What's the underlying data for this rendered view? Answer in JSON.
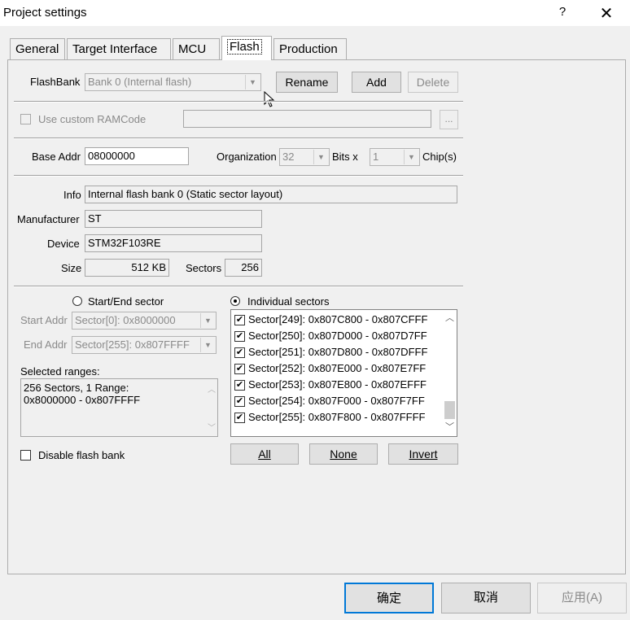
{
  "window": {
    "title": "Project settings",
    "help": "?",
    "close": "✕"
  },
  "tabs": [
    "General",
    "Target Interface",
    "MCU",
    "Flash",
    "Production"
  ],
  "flashbank": {
    "label": "FlashBank",
    "value": "Bank 0 (Internal flash)",
    "rename": "Rename",
    "add": "Add",
    "delete": "Delete"
  },
  "ramcode": {
    "label": "Use custom RAMCode",
    "value": "",
    "browse": "..."
  },
  "base": {
    "base_addr_label": "Base Addr",
    "base_addr": "08000000",
    "org_label": "Organization",
    "org_value": "32",
    "bits_label": "Bits x",
    "chips_value": "1",
    "chips_label": "Chip(s)"
  },
  "info": {
    "info_label": "Info",
    "info": "Internal flash bank 0 (Static sector layout)",
    "manufacturer_label": "Manufacturer",
    "manufacturer": "ST",
    "device_label": "Device",
    "device": "STM32F103RE",
    "size_label": "Size",
    "size": "512 KB",
    "sectors_label": "Sectors",
    "sectors": "256"
  },
  "range": {
    "start_end_label": "Start/End sector",
    "individual_label": "Individual sectors",
    "start_label": "Start Addr",
    "start_value": "Sector[0]: 0x8000000",
    "end_label": "End Addr",
    "end_value": "Sector[255]: 0x807FFFF",
    "selected_label": "Selected ranges:",
    "selected_line1": "256 Sectors, 1 Range:",
    "selected_line2": "0x8000000 - 0x807FFFF"
  },
  "sectors_list": [
    "Sector[249]: 0x807C800 - 0x807CFFF",
    "Sector[250]: 0x807D000 - 0x807D7FF",
    "Sector[251]: 0x807D800 - 0x807DFFF",
    "Sector[252]: 0x807E000 - 0x807E7FF",
    "Sector[253]: 0x807E800 - 0x807EFFF",
    "Sector[254]: 0x807F000 - 0x807F7FF",
    "Sector[255]: 0x807F800 - 0x807FFFF"
  ],
  "list_buttons": {
    "all": "All",
    "none": "None",
    "invert": "Invert"
  },
  "disable_flash_bank": "Disable flash bank",
  "footer": {
    "ok": "确定",
    "cancel": "取消",
    "apply": "应用(A)"
  }
}
